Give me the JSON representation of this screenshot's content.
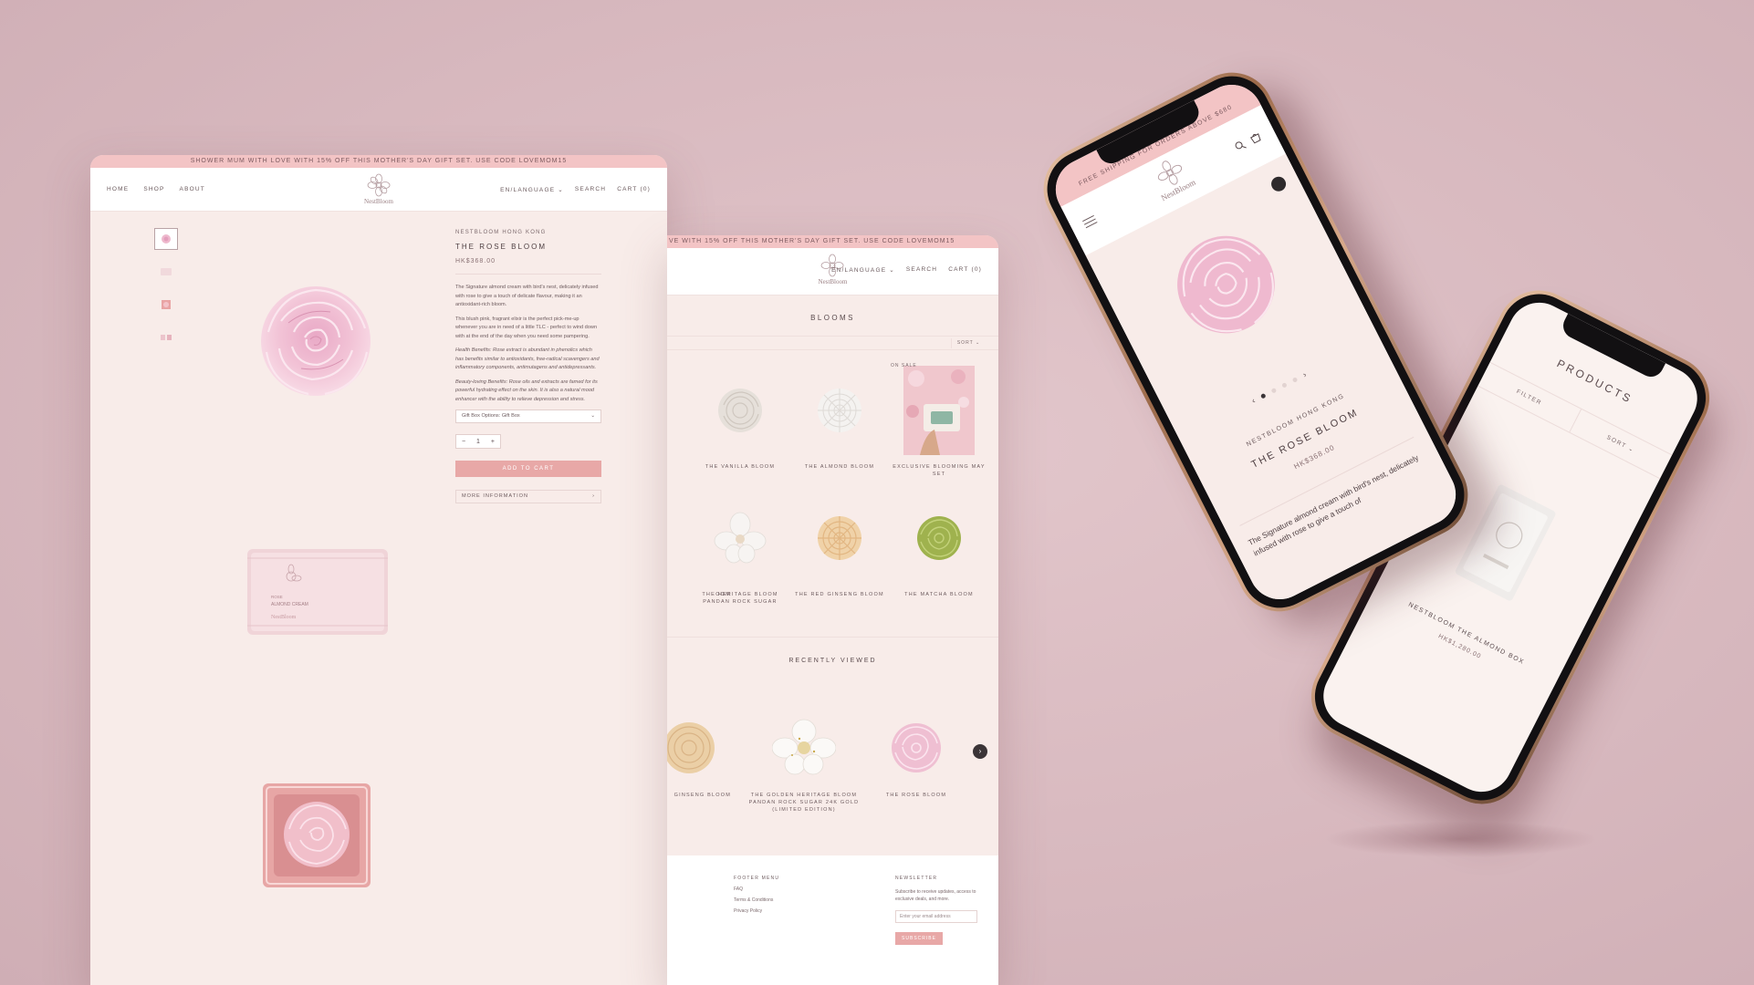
{
  "colors": {
    "background": "#dcbfc4",
    "accent": "#e8a8a7",
    "promo": "#f3c4c5",
    "page": "#f8ece9"
  },
  "desktop_product": {
    "promo": "SHOWER MUM WITH LOVE WITH 15% OFF THIS MOTHER'S DAY GIFT SET. USE CODE LOVEMOM15",
    "nav": {
      "home": "HOME",
      "shop": "SHOP",
      "about": "ABOUT",
      "language": "EN/LANGUAGE ⌄",
      "search": "SEARCH",
      "cart": "CART (0)"
    },
    "logo": "NestBloom",
    "brand": "NESTBLOOM HONG KONG",
    "title": "THE ROSE BLOOM",
    "price": "HK$368.00",
    "desc1": "The Signature almond cream with bird's nest, delicately infused with rose to give a touch of delicate flavour, making it an antioxidant-rich bloom.",
    "desc2": "This blush pink, fragrant elixir is the perfect pick-me-up whenever you are in need of a little TLC - perfect to wind down with at the end of the day when you need some pampering.",
    "desc3": "Health Benefits: Rose extract is abundant in phenolics which has benefits similar to antioxidants, free-radical scavengers and inflammatory components, antimutagens and antidepressants.",
    "desc4": "Beauty-loving Benefits: Rose oils and extracts are famed for its powerful hydrating effect on the skin. It is also a natural mood enhancer with the ability to relieve depression and stress.",
    "option": "Gift Box Options: Gift Box",
    "qty": "1",
    "add_to_cart": "ADD TO CART",
    "more_info": "MORE INFORMATION"
  },
  "desktop_collection": {
    "promo": "VE WITH 15% OFF THIS MOTHER'S DAY GIFT SET. USE CODE LOVEMOM15",
    "nav": {
      "language": "EN/LANGUAGE ⌄",
      "search": "SEARCH",
      "cart": "CART (0)"
    },
    "logo": "NestBloom",
    "title": "BLOOMS",
    "sort": "SORT ⌄",
    "products": [
      {
        "name": "THE VANILLA BLOOM"
      },
      {
        "name": "THE ALMOND BLOOM"
      },
      {
        "name": "EXCLUSIVE BLOOMING MAY SET",
        "badge": "ON SALE"
      },
      {
        "name": "OOM"
      },
      {
        "name": "THE HERITAGE BLOOM PANDAN ROCK SUGAR"
      },
      {
        "name": "THE RED GINSENG BLOOM"
      },
      {
        "name": "THE MATCHA BLOOM"
      }
    ],
    "recently_viewed": "RECENTLY VIEWED",
    "recent": [
      {
        "name": "GINSENG BLOOM"
      },
      {
        "name": "THE GOLDEN HERITAGE BLOOM PANDAN ROCK SUGAR 24K GOLD (LIMITED EDITION)"
      },
      {
        "name": "THE ROSE BLOOM"
      }
    ],
    "footer": {
      "menu_title": "FOOTER MENU",
      "links": [
        "FAQ",
        "Terms & Conditions",
        "Privacy Policy"
      ],
      "newsletter_title": "NEWSLETTER",
      "newsletter_text": "Subscribe to receive updates, access to exclusive deals, and more.",
      "email_placeholder": "Enter your email address",
      "subscribe": "SUBSCRIBE"
    }
  },
  "phone_product": {
    "promo": "FREE SHIPPING FOR ORDERS ABOVE $680",
    "logo": "NestBloom",
    "brand": "NESTBLOOM HONG KONG",
    "title": "THE ROSE BLOOM",
    "price": "HK$368.00",
    "desc": "The Signature almond cream with bird's nest, delicately infused with rose to give a touch of"
  },
  "phone_collection": {
    "title": "PRODUCTS",
    "filter": "FILTER",
    "sort": "SORT ⌄",
    "product_name": "NESTBLOOM THE ALMOND BOX",
    "product_price": "HK$1,280.00"
  }
}
